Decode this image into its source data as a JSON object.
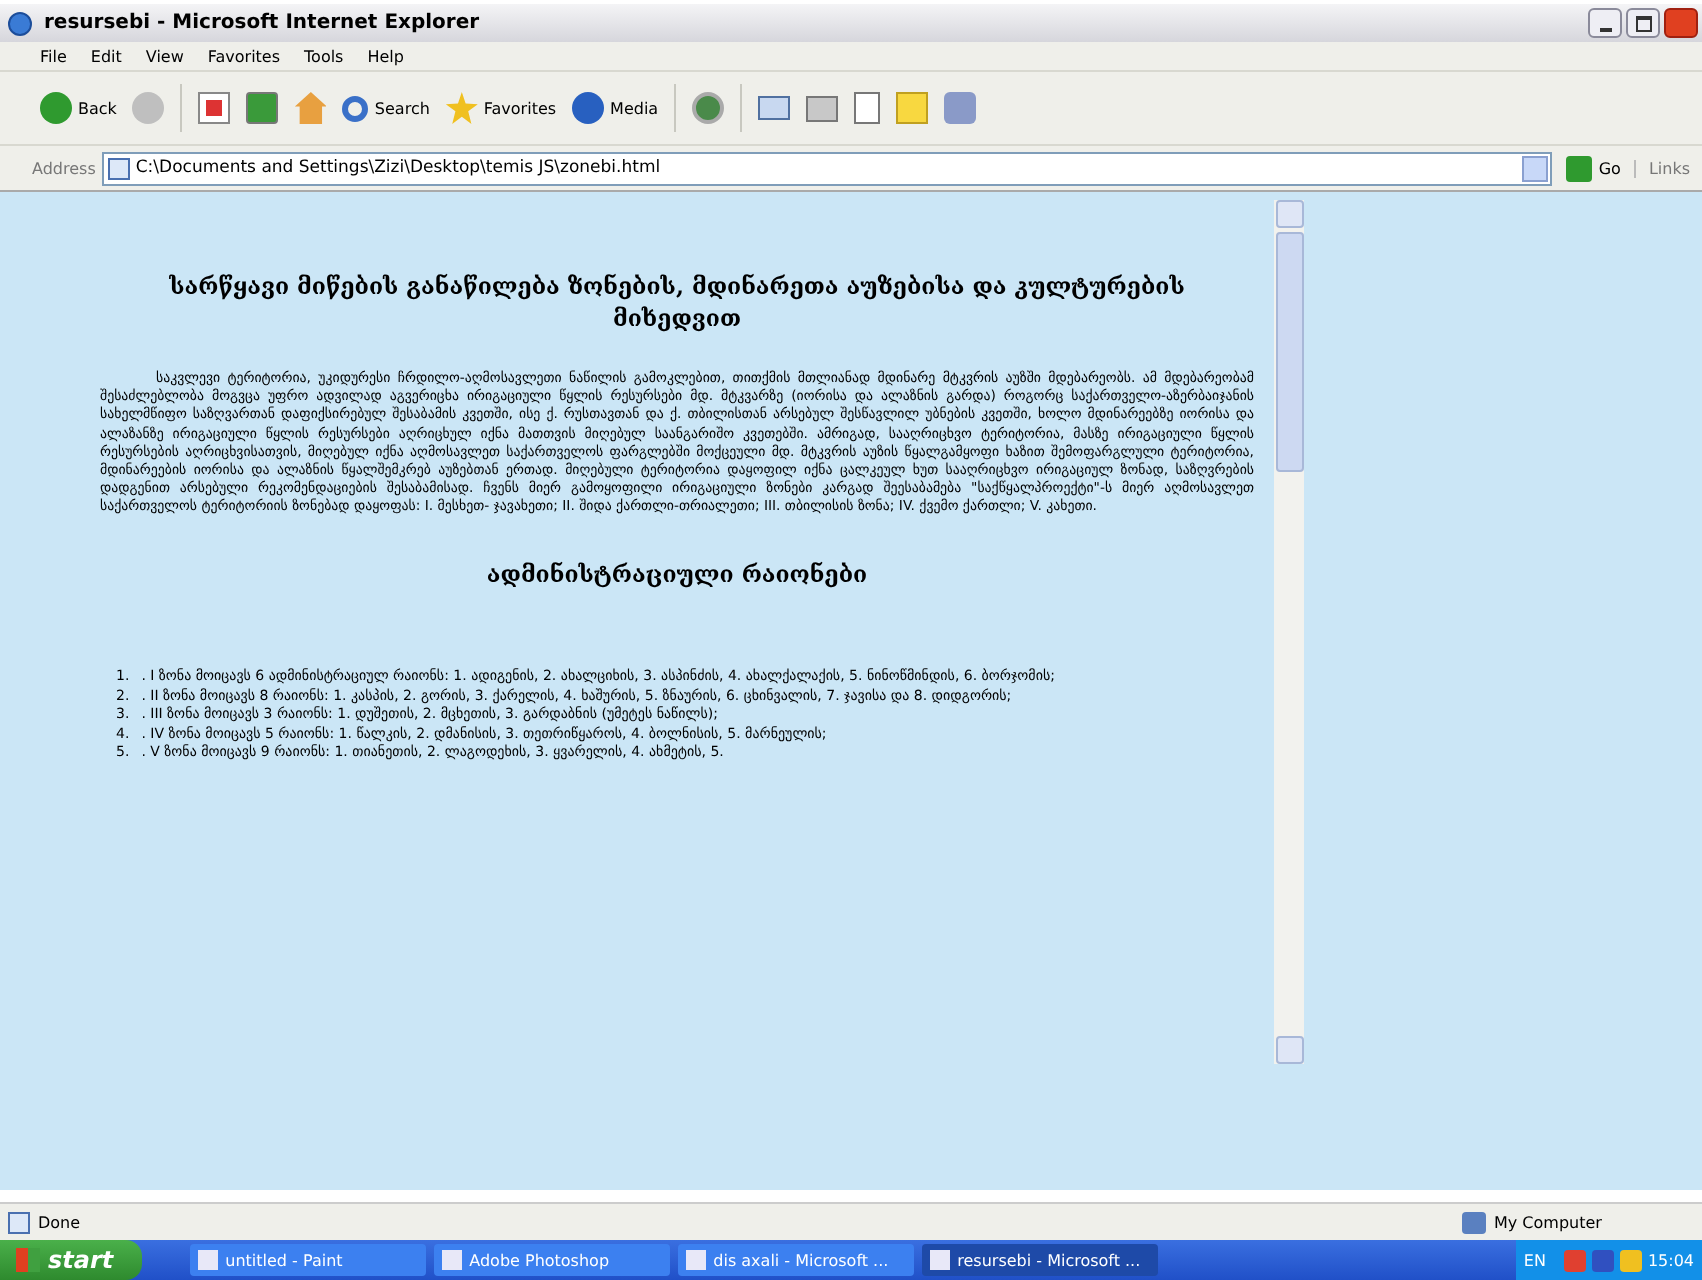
{
  "window": {
    "title": "resursebi - Microsoft Internet Explorer"
  },
  "menu": [
    "File",
    "Edit",
    "View",
    "Favorites",
    "Tools",
    "Help"
  ],
  "toolbar": [
    {
      "kind": "back",
      "label": "Back"
    },
    {
      "kind": "forward"
    },
    {
      "kind": "stop"
    },
    {
      "kind": "refresh"
    },
    {
      "kind": "home"
    },
    {
      "kind": "search",
      "label": "Search"
    },
    {
      "kind": "favorites",
      "label": "Favorites"
    },
    {
      "kind": "media",
      "label": "Media"
    },
    {
      "kind": "history"
    },
    {
      "kind": "mail"
    },
    {
      "kind": "print"
    },
    {
      "kind": "edit"
    },
    {
      "kind": "notes"
    },
    {
      "kind": "messenger"
    }
  ],
  "address": {
    "label": "Address",
    "value": "C:\\Documents and Settings\\Zizi\\Desktop\\temis JS\\zonebi.html",
    "go": "Go",
    "links": "Links"
  },
  "document": {
    "heading": "სარწყავი მიწების განაწილება ზონების, მდინარეთა აუზებისა და კულტურების მიხედვით",
    "paragraph": "საკვლევი ტერიტორია, უკიდურესი ჩრდილო-აღმოსავლეთი ნაწილის გამოკლებით, თითქმის მთლიანად მდინარე მტკვრის აუზში მდებარეობს. ამ მდებარეობამ შესაძლებლობა მოგვცა უფრო ადვილად აგვერიცხა ირიგაციული წყლის რესურსები მდ. მტკვარზე (იორისა და ალაზნის გარდა) როგორც საქართველო-აზერბაიჯანის სახელმწიფო საზღვართან დაფიქსირებულ შესაბამის კვეთში, ისე ქ. რუსთავთან და ქ. თბილისთან არსებულ შესწავლილ უბნების კვეთში, ხოლო მდინარეებზე იორისა და ალაზანზე ირიგაციული წყლის რესურსები აღრიცხულ იქნა მათთვის მიღებულ საანგარიშო კვეთებში. ამრიგად, სააღრიცხვო ტერიტორია, მასზე ირიგაციული წყლის რესურსების აღრიცხვისათვის, მიღებულ იქნა აღმოსავლეთ საქართველოს ფარგლებში მოქცეული მდ. მტკვრის აუზის წყალგამყოფი ხაზით შემოფარგლული ტერიტორია, მდინარეების იორისა და ალაზნის წყალშემკრებ აუზებთან ერთად. მიღებული ტერიტორია დაყოფილ იქნა ცალკეულ ხუთ სააღრიცხვო ირიგაციულ ზონად, საზღვრების დადგენით არსებული რეკომენდაციების შესაბამისად. ჩვენს მიერ გამოყოფილი ირიგაციული ზონები კარგად შეესაბამება \"საქწყალპროექტი\"-ს მიერ აღმოსავლეთ საქართველოს ტერიტორიის ზონებად დაყოფას: I. მესხეთ- ჯავახეთი; II. შიდა ქართლი-თრიალეთი; III. თბილისის ზონა; IV. ქვემო ქართლი; V. კახეთი.",
    "subheading": "ადმინისტრაციული რაიონები",
    "list": [
      {
        "number": "1.",
        "text": ". I ზონა მოიცავს 6 ადმინისტრაციულ რაიონს: 1. ადიგენის, 2. ახალციხის, 3. ასპინძის, 4. ახალქალაქის, 5. ნინოწმინდის, 6. ბორჯომის;"
      },
      {
        "number": "2.",
        "text": ". II ზონა მოიცავს 8 რაიონს: 1. კასპის, 2. გორის, 3. ქარელის, 4. ხაშურის, 5. ზნაურის, 6. ცხინვალის, 7. ჯავისა და 8. დიდგორის;"
      },
      {
        "number": "3.",
        "text": ". III ზონა მოიცავს 3 რაიონს: 1. დუშეთის, 2. მცხეთის, 3. გარდაბნის (უმეტეს ნაწილს);"
      },
      {
        "number": "4.",
        "text": ". IV ზონა მოიცავს 5 რაიონს: 1. წალკის, 2. დმანისის, 3. თეთრიწყაროს, 4. ბოლნისის, 5. მარნეულის;"
      },
      {
        "number": "5.",
        "text": ". V ზონა მოიცავს 9 რაიონს: 1. თიანეთის, 2. ლაგოდეხის, 3. ყვარელის, 4. ახმეტის, 5."
      }
    ]
  },
  "status_bar": {
    "text": "Done",
    "zone": "My Computer"
  },
  "taskbar": {
    "start": "start",
    "tasks": [
      {
        "label": "untitled - Paint",
        "selected": false
      },
      {
        "label": "Adobe Photoshop",
        "selected": false
      },
      {
        "label": "dis axali - Microsoft ...",
        "selected": false
      },
      {
        "label": "resursebi - Microsoft ...",
        "selected": true
      }
    ],
    "language": "EN",
    "clock": "15:04"
  }
}
